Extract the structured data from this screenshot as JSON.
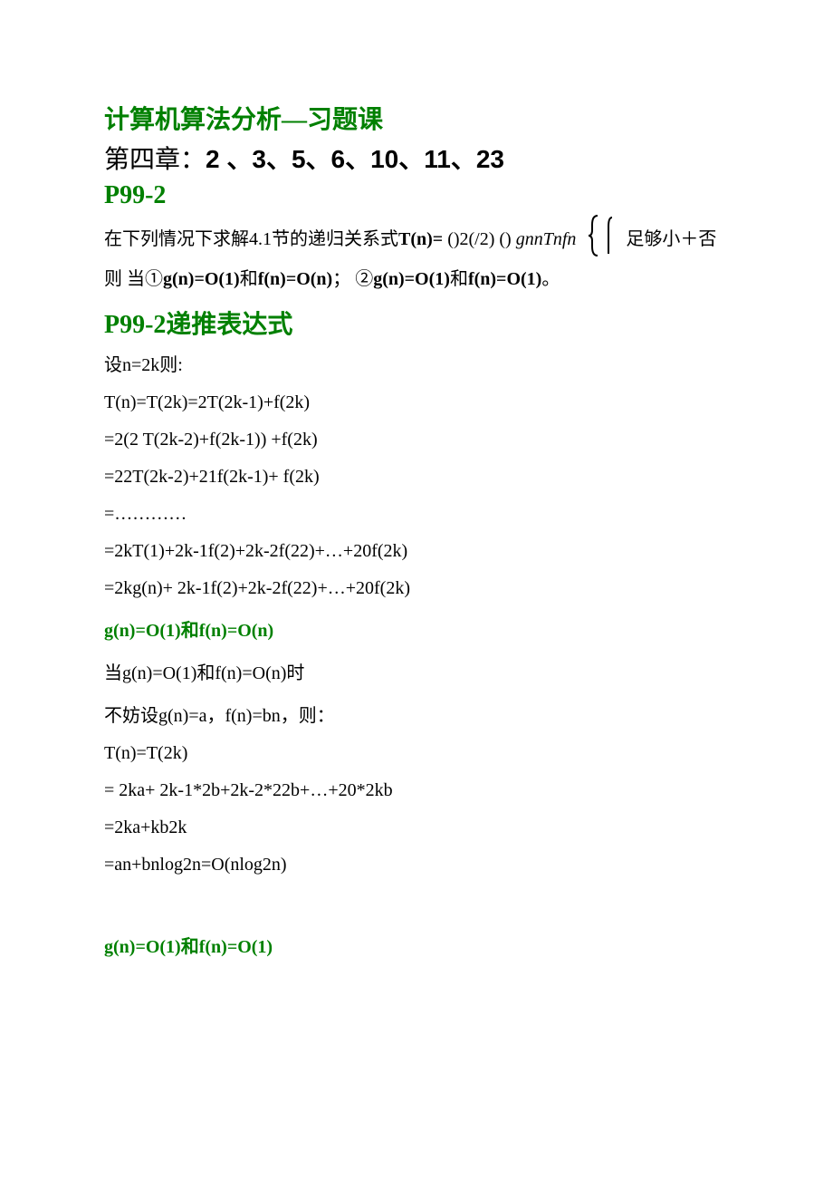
{
  "title": "计算机算法分析—习题课",
  "subtitle_prefix": "第四章：",
  "subtitle_nums": "2 、3、5、6、10、11、23",
  "sec1": "P99-2",
  "p1_a": "在下列情况下求解4.1节的递归关系式",
  "p1_b": "T(n)=",
  "p1_c": " ()2(/2) () ",
  "p1_d": "gnnTnfn",
  "p1_e": " 足够小＋否则  当①",
  "p1_f": "g(n)=O(1)",
  "p1_g": "和",
  "p1_h": "f(n)=O(n)",
  "p1_i": "；   ②",
  "p1_j": "g(n)=O(1)",
  "p1_k": "和",
  "p1_l": "f(n)=O(1)",
  "p1_m": "。",
  "sec2": "P99-2递推表达式",
  "m1": "设n=2k则:",
  "m2": "T(n)=T(2k)=2T(2k-1)+f(2k)",
  "m3": "=2(2 T(2k-2)+f(2k-1)) +f(2k)",
  "m4": "=22T(2k-2)+21f(2k-1)+ f(2k)",
  "m5": "=…………",
  "m6": "=2kT(1)+2k-1f(2)+2k-2f(22)+…+20f(2k)",
  "m7": "=2kg(n)+ 2k-1f(2)+2k-2f(22)+…+20f(2k)",
  "sec3a": "g(n)=O(1)",
  "sec3b": "和",
  "sec3c": "f(n)=O(n)",
  "m8": "当g(n)=O(1)和f(n)=O(n)时",
  "m9": "不妨设g(n)=a，f(n)=bn，则：",
  "m10": "T(n)=T(2k)",
  "m11": "= 2ka+ 2k-1*2b+2k-2*22b+…+20*2kb",
  "m12": "=2ka+kb2k",
  "m13": "=an+bnlog2n=O(nlog2n)",
  "sec4a": "g(n)=O(1)",
  "sec4b": "和",
  "sec4c": "f(n)=O(1)"
}
